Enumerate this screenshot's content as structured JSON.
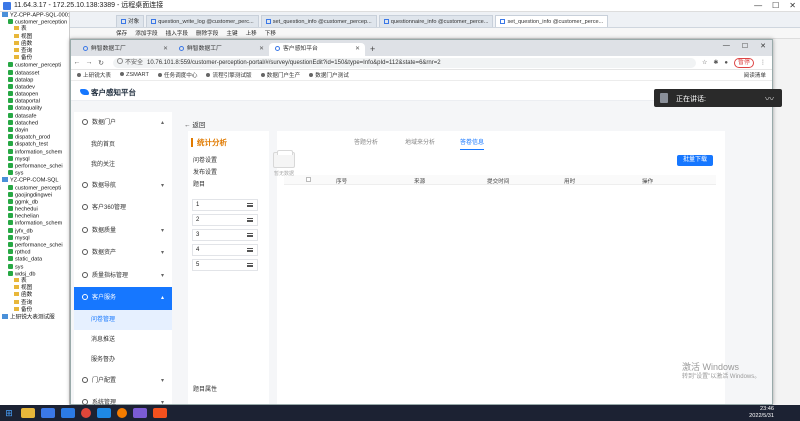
{
  "remote_title": "11.64.3.17 - 172.25.10.138:3389 - 远程桌面连接",
  "tree": [
    {
      "t": "YZ-CPP-APP-SQL-0001",
      "lvl": 0,
      "ic": "srv"
    },
    {
      "t": "customer_perception",
      "lvl": 1,
      "ic": "db"
    },
    {
      "t": "表",
      "lvl": 2,
      "ic": "fd"
    },
    {
      "t": "视图",
      "lvl": 2,
      "ic": "fd"
    },
    {
      "t": "函数",
      "lvl": 2,
      "ic": "fd"
    },
    {
      "t": "查询",
      "lvl": 2,
      "ic": "fd"
    },
    {
      "t": "备份",
      "lvl": 2,
      "ic": "fd"
    },
    {
      "t": "customer_percepti",
      "lvl": 1,
      "ic": "db"
    },
    {
      "t": "dataasset",
      "lvl": 1,
      "ic": "db"
    },
    {
      "t": "datalap",
      "lvl": 1,
      "ic": "db"
    },
    {
      "t": "datadev",
      "lvl": 1,
      "ic": "db"
    },
    {
      "t": "dataopen",
      "lvl": 1,
      "ic": "db"
    },
    {
      "t": "dataportal",
      "lvl": 1,
      "ic": "db"
    },
    {
      "t": "dataquality",
      "lvl": 1,
      "ic": "db"
    },
    {
      "t": "datasafe",
      "lvl": 1,
      "ic": "db"
    },
    {
      "t": "datached",
      "lvl": 1,
      "ic": "db"
    },
    {
      "t": "dayin",
      "lvl": 1,
      "ic": "db"
    },
    {
      "t": "dispatch_prod",
      "lvl": 1,
      "ic": "db"
    },
    {
      "t": "dispatch_test",
      "lvl": 1,
      "ic": "db"
    },
    {
      "t": "information_schem",
      "lvl": 1,
      "ic": "db"
    },
    {
      "t": "mysql",
      "lvl": 1,
      "ic": "db"
    },
    {
      "t": "performance_schei",
      "lvl": 1,
      "ic": "db"
    },
    {
      "t": "sys",
      "lvl": 1,
      "ic": "db"
    },
    {
      "t": "YZ-CPP-COM-SQL",
      "lvl": 0,
      "ic": "srv"
    },
    {
      "t": "customer_percepti",
      "lvl": 1,
      "ic": "db"
    },
    {
      "t": "gaojingdingwei",
      "lvl": 1,
      "ic": "db"
    },
    {
      "t": "ggmk_db",
      "lvl": 1,
      "ic": "db"
    },
    {
      "t": "hechedui",
      "lvl": 1,
      "ic": "db"
    },
    {
      "t": "hechelian",
      "lvl": 1,
      "ic": "db"
    },
    {
      "t": "information_schem",
      "lvl": 1,
      "ic": "db"
    },
    {
      "t": "jyfx_db",
      "lvl": 1,
      "ic": "db"
    },
    {
      "t": "mysql",
      "lvl": 1,
      "ic": "db"
    },
    {
      "t": "performance_schei",
      "lvl": 1,
      "ic": "db"
    },
    {
      "t": "rpthcd",
      "lvl": 1,
      "ic": "db"
    },
    {
      "t": "static_data",
      "lvl": 1,
      "ic": "db"
    },
    {
      "t": "sys",
      "lvl": 1,
      "ic": "db"
    },
    {
      "t": "wdsj_db",
      "lvl": 1,
      "ic": "db"
    },
    {
      "t": "表",
      "lvl": 2,
      "ic": "fd"
    },
    {
      "t": "视图",
      "lvl": 2,
      "ic": "fd"
    },
    {
      "t": "函数",
      "lvl": 2,
      "ic": "fd"
    },
    {
      "t": "查询",
      "lvl": 2,
      "ic": "fd"
    },
    {
      "t": "备份",
      "lvl": 2,
      "ic": "fd"
    },
    {
      "t": "上研锐大表测试服",
      "lvl": 0,
      "ic": "srv"
    }
  ],
  "nav_tabs": [
    "对象",
    "question_write_log @customer_perc...",
    "set_question_info @customer_percep...",
    "questionnaire_info @customer_perce...",
    "set_question_info @customer_perce..."
  ],
  "nav_toolbar": [
    "保存",
    "添加字段",
    "插入字段",
    "删除字段",
    "主键",
    "上移",
    "下移"
  ],
  "browser": {
    "tabs": [
      "鲜智数据工厂",
      "鲜智数据工厂",
      "客户感知平台"
    ],
    "not_secure": "不安全",
    "url": "10.76.101.8:559/customer-perception-portal/#/survey/questionEdit?id=150&type=Info&pId=112&state=6&rnr=2",
    "pause": "暂停",
    "bookmarks": [
      "上研锐大表",
      "ZSMART",
      "任务调度中心",
      "流程引擎测试版",
      "数据门户生产",
      "数据门户测试"
    ],
    "reading_list": "阅读清单"
  },
  "app": {
    "logo": "客户感知平台",
    "menu": [
      {
        "label": "数据门户",
        "arrow": "▴",
        "active": false,
        "subs": [
          "我的首页",
          "我的关注"
        ]
      },
      {
        "label": "数据导航",
        "arrow": "▾",
        "active": false,
        "subs": []
      },
      {
        "label": "客户360管理",
        "arrow": "",
        "active": false,
        "subs": []
      },
      {
        "label": "数据质量",
        "arrow": "▾",
        "active": false,
        "subs": []
      },
      {
        "label": "数据资产",
        "arrow": "▾",
        "active": false,
        "subs": []
      },
      {
        "label": "质量指标管理",
        "arrow": "▾",
        "active": false,
        "subs": []
      },
      {
        "label": "客户服务",
        "arrow": "▴",
        "active": true,
        "subs": [
          "问卷管理",
          "消息推送",
          "服务督办"
        ]
      },
      {
        "label": "门户配置",
        "arrow": "▾",
        "active": false,
        "subs": []
      },
      {
        "label": "系统管理",
        "arrow": "▾",
        "active": false,
        "subs": []
      }
    ],
    "back": "返回",
    "side": {
      "title": "统计分析",
      "links": [
        "问卷设置",
        "发布设置",
        "题目"
      ],
      "rows": [
        "1",
        "2",
        "3",
        "4",
        "5"
      ],
      "footer": "题目属性"
    },
    "content_tabs": [
      "答题分析",
      "地域来分析",
      "答卷信息"
    ],
    "bulk_download": "批量下载",
    "columns": [
      "序号",
      "来源",
      "提交时间",
      "用时",
      "操作"
    ],
    "empty": "暂无数据"
  },
  "talking": "正在讲话:",
  "win_activate": {
    "title": "激活 Windows",
    "sub": "转到\"设置\"以激活 Windows。"
  },
  "clock": {
    "time": "23:46",
    "date": "2022/5/31"
  },
  "colors": {
    "accent": "#1677ff",
    "stat": "#e07a00"
  }
}
